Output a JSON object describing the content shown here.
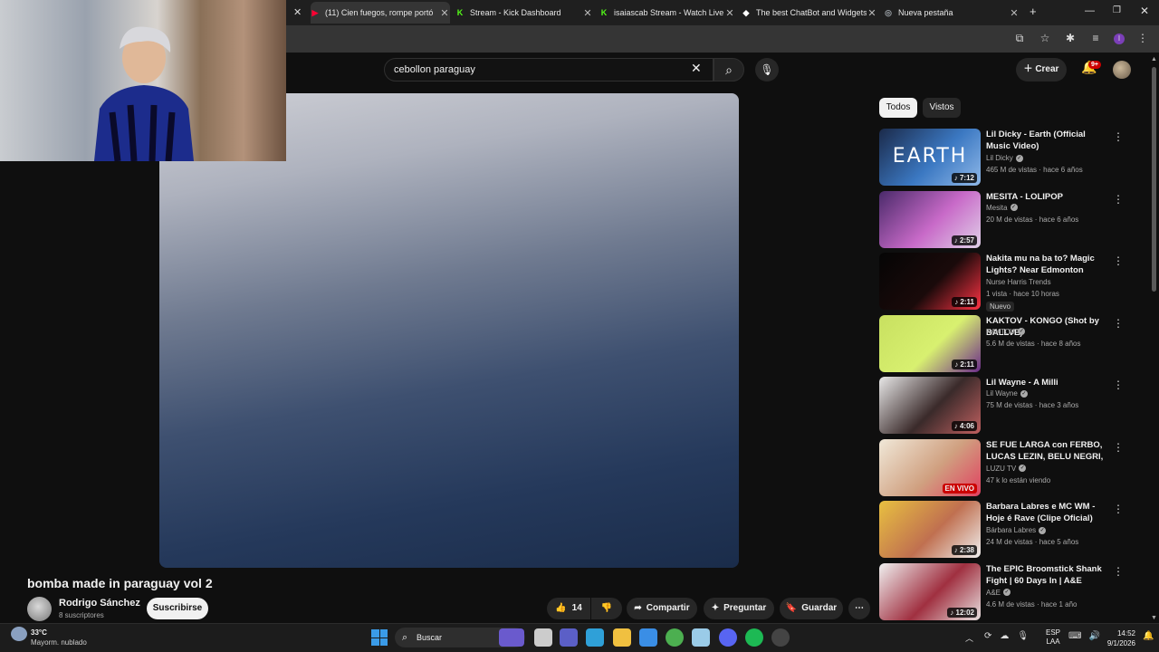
{
  "browser": {
    "tabs": [
      {
        "label": "(11) Cien fuegos, rompe portó",
        "color": "#ff0033",
        "glyph": "▶"
      },
      {
        "label": "Stream - Kick Dashboard",
        "color": "#53fc18",
        "glyph": "K"
      },
      {
        "label": "isaiascab Stream - Watch Live o",
        "color": "#53fc18",
        "glyph": "K"
      },
      {
        "label": "The best ChatBot and Widgets",
        "color": "#ffffff",
        "glyph": "◆"
      },
      {
        "label": "Nueva pestaña",
        "color": "#9aa0a6",
        "glyph": "◎"
      }
    ],
    "new_tab": "+",
    "profile_initial": "I"
  },
  "header": {
    "search_value": "cebollon paraguay",
    "create_label": "Crear",
    "notif_badge": "9+"
  },
  "video": {
    "title": "bomba made in paraguay vol 2",
    "channel": "Rodrigo Sánchez",
    "subscribers": "8 suscriptores",
    "subscribe_label": "Suscribirse",
    "actions": {
      "likes": "14",
      "share": "Compartir",
      "ask": "Preguntar",
      "save": "Guardar"
    }
  },
  "sidebar": {
    "chips": [
      "Todos",
      "Vistos"
    ],
    "items": [
      {
        "title": "Lil Dicky - Earth (Official Music Video)",
        "channel": "Lil Dicky",
        "verified": true,
        "meta": "465 M de vistas · hace 6 años",
        "duration": "7:12",
        "thumb_text": "EARTH",
        "colors": [
          "#1b2a4a",
          "#3b78c2",
          "#8fb8e8"
        ]
      },
      {
        "title": "MESITA - LOLIPOP",
        "channel": "Mesita",
        "verified": true,
        "meta": "20 M de vistas · hace 6 años",
        "duration": "2:57",
        "thumb_text": "",
        "colors": [
          "#4a2a6a",
          "#c86ac8",
          "#e0d0e8"
        ]
      },
      {
        "title": "Nakita mu na ba to? Magic Lights? Near Edmonton Airpor...",
        "channel": "Nurse Harris Trends",
        "verified": false,
        "meta": "1 vista · hace 10 horas",
        "badge": "Nuevo",
        "duration": "2:11",
        "thumb_text": "",
        "colors": [
          "#050505",
          "#1a0a0a",
          "#ff3344"
        ]
      },
      {
        "title": "KAKTOV - KONGO (Shot by BALLVE)",
        "channel": "KAKTOV",
        "verified": true,
        "meta": "5.6 M de vistas · hace 8 años",
        "duration": "2:11",
        "thumb_text": "",
        "colors": [
          "#c8e060",
          "#d8f070",
          "#6a2a8a"
        ]
      },
      {
        "title": "Lil Wayne - A Milli",
        "channel": "Lil Wayne",
        "verified": true,
        "meta": "75 M de vistas · hace 3 años",
        "duration": "4:06",
        "thumb_text": "",
        "colors": [
          "#e8e8e8",
          "#3a2a2a",
          "#c06060"
        ]
      },
      {
        "title": "SE FUE LARGA con FERBO, LUCAS LEZIN, BELU NEGRI, ...",
        "channel": "LUZU TV",
        "verified": true,
        "meta": "47 k lo están viendo",
        "live": "EN VIVO",
        "thumb_text": "",
        "colors": [
          "#f0e8d8",
          "#d0a080",
          "#e04060"
        ]
      },
      {
        "title": "Barbara Labres e MC WM - Hoje é Rave (Clipe Oficial)",
        "channel": "Bárbara Labres",
        "verified": true,
        "meta": "24 M de vistas · hace 5 años",
        "duration": "2:38",
        "thumb_text": "",
        "colors": [
          "#e8c040",
          "#c07050",
          "#f0f0f0"
        ]
      },
      {
        "title": "The EPIC Broomstick Shank Fight | 60 Days In | A&E",
        "channel": "A&E",
        "verified": true,
        "meta": "4.6 M de vistas · hace 1 año",
        "duration": "12:02",
        "thumb_text": "",
        "colors": [
          "#f0f0f0",
          "#a03040",
          "#e8e0e0"
        ]
      }
    ]
  },
  "taskbar": {
    "weather_temp": "33°C",
    "weather_desc": "Mayorm. nublado",
    "search_placeholder": "Buscar",
    "lang1": "ESP",
    "lang2": "LAA",
    "time": "14:52",
    "date": "9/1/2026"
  }
}
